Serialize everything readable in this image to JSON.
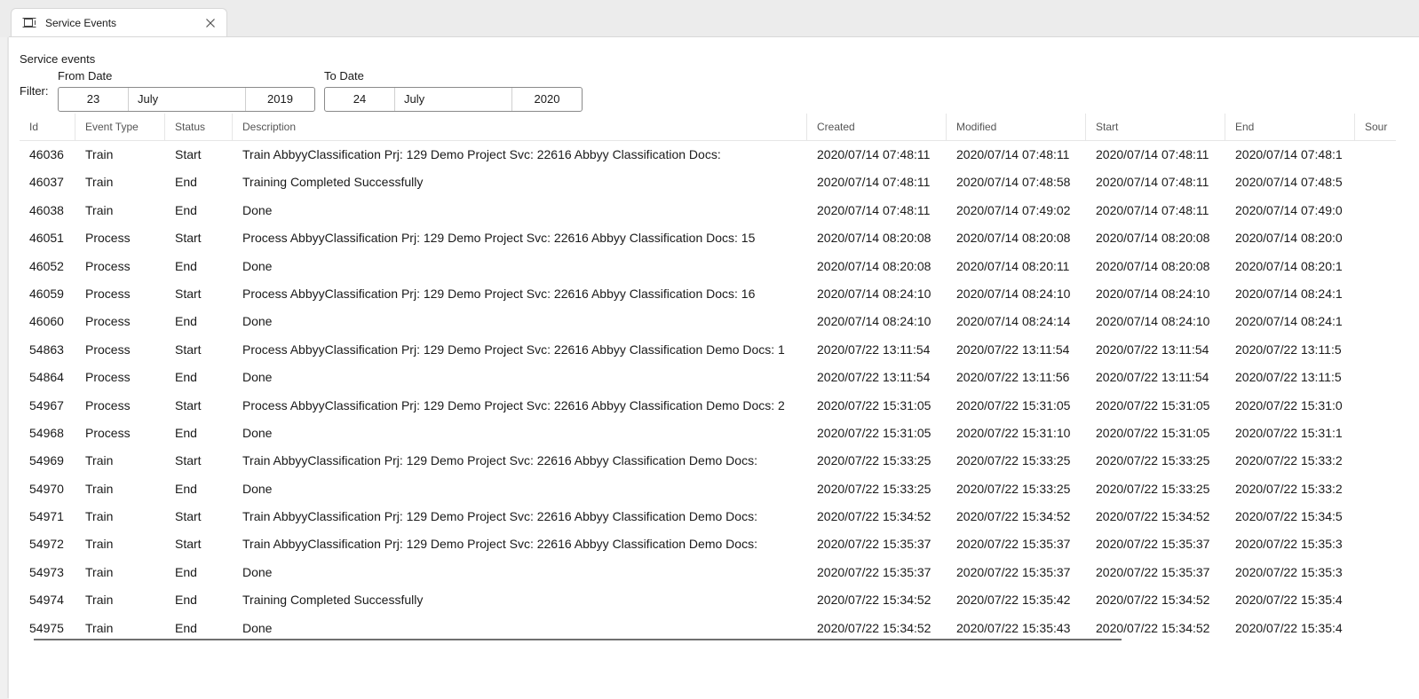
{
  "tab": {
    "title": "Service Events",
    "icon": "service-events-icon",
    "close_icon": "close-icon"
  },
  "page": {
    "title": "Service events",
    "filter_label": "Filter:",
    "from_date": {
      "label": "From Date",
      "day": "23",
      "month": "July",
      "year": "2019"
    },
    "to_date": {
      "label": "To Date",
      "day": "24",
      "month": "July",
      "year": "2020"
    }
  },
  "table": {
    "columns": [
      "Id",
      "Event Type",
      "Status",
      "Description",
      "Created",
      "Modified",
      "Start",
      "End",
      "Sour"
    ],
    "rows": [
      [
        "46036",
        "Train",
        "Start",
        "Train AbbyyClassification Prj: 129 Demo Project Svc: 22616 Abbyy Classification Docs:",
        "2020/07/14 07:48:11",
        "2020/07/14 07:48:11",
        "2020/07/14 07:48:11",
        "2020/07/14 07:48:1"
      ],
      [
        "46037",
        "Train",
        "End",
        "Training Completed Successfully",
        "2020/07/14 07:48:11",
        "2020/07/14 07:48:58",
        "2020/07/14 07:48:11",
        "2020/07/14 07:48:5"
      ],
      [
        "46038",
        "Train",
        "End",
        "Done",
        "2020/07/14 07:48:11",
        "2020/07/14 07:49:02",
        "2020/07/14 07:48:11",
        "2020/07/14 07:49:0"
      ],
      [
        "46051",
        "Process",
        "Start",
        "Process AbbyyClassification Prj: 129 Demo Project Svc: 22616 Abbyy Classification Docs: 15",
        "2020/07/14 08:20:08",
        "2020/07/14 08:20:08",
        "2020/07/14 08:20:08",
        "2020/07/14 08:20:0"
      ],
      [
        "46052",
        "Process",
        "End",
        "Done",
        "2020/07/14 08:20:08",
        "2020/07/14 08:20:11",
        "2020/07/14 08:20:08",
        "2020/07/14 08:20:1"
      ],
      [
        "46059",
        "Process",
        "Start",
        "Process AbbyyClassification Prj: 129 Demo Project Svc: 22616 Abbyy Classification Docs: 16",
        "2020/07/14 08:24:10",
        "2020/07/14 08:24:10",
        "2020/07/14 08:24:10",
        "2020/07/14 08:24:1"
      ],
      [
        "46060",
        "Process",
        "End",
        "Done",
        "2020/07/14 08:24:10",
        "2020/07/14 08:24:14",
        "2020/07/14 08:24:10",
        "2020/07/14 08:24:1"
      ],
      [
        "54863",
        "Process",
        "Start",
        "Process AbbyyClassification Prj: 129 Demo Project Svc: 22616 Abbyy Classification Demo Docs: 1",
        "2020/07/22 13:11:54",
        "2020/07/22 13:11:54",
        "2020/07/22 13:11:54",
        "2020/07/22 13:11:5"
      ],
      [
        "54864",
        "Process",
        "End",
        "Done",
        "2020/07/22 13:11:54",
        "2020/07/22 13:11:56",
        "2020/07/22 13:11:54",
        "2020/07/22 13:11:5"
      ],
      [
        "54967",
        "Process",
        "Start",
        "Process AbbyyClassification Prj: 129 Demo Project Svc: 22616 Abbyy Classification Demo Docs: 2",
        "2020/07/22 15:31:05",
        "2020/07/22 15:31:05",
        "2020/07/22 15:31:05",
        "2020/07/22 15:31:0"
      ],
      [
        "54968",
        "Process",
        "End",
        "Done",
        "2020/07/22 15:31:05",
        "2020/07/22 15:31:10",
        "2020/07/22 15:31:05",
        "2020/07/22 15:31:1"
      ],
      [
        "54969",
        "Train",
        "Start",
        "Train AbbyyClassification Prj: 129 Demo Project Svc: 22616 Abbyy Classification Demo Docs:",
        "2020/07/22 15:33:25",
        "2020/07/22 15:33:25",
        "2020/07/22 15:33:25",
        "2020/07/22 15:33:2"
      ],
      [
        "54970",
        "Train",
        "End",
        "Done",
        "2020/07/22 15:33:25",
        "2020/07/22 15:33:25",
        "2020/07/22 15:33:25",
        "2020/07/22 15:33:2"
      ],
      [
        "54971",
        "Train",
        "Start",
        "Train AbbyyClassification Prj: 129 Demo Project Svc: 22616 Abbyy Classification Demo Docs:",
        "2020/07/22 15:34:52",
        "2020/07/22 15:34:52",
        "2020/07/22 15:34:52",
        "2020/07/22 15:34:5"
      ],
      [
        "54972",
        "Train",
        "Start",
        "Train AbbyyClassification Prj: 129 Demo Project Svc: 22616 Abbyy Classification Demo Docs:",
        "2020/07/22 15:35:37",
        "2020/07/22 15:35:37",
        "2020/07/22 15:35:37",
        "2020/07/22 15:35:3"
      ],
      [
        "54973",
        "Train",
        "End",
        "Done",
        "2020/07/22 15:35:37",
        "2020/07/22 15:35:37",
        "2020/07/22 15:35:37",
        "2020/07/22 15:35:3"
      ],
      [
        "54974",
        "Train",
        "End",
        "Training Completed Successfully",
        "2020/07/22 15:34:52",
        "2020/07/22 15:35:42",
        "2020/07/22 15:34:52",
        "2020/07/22 15:35:4"
      ],
      [
        "54975",
        "Train",
        "End",
        "Done",
        "2020/07/22 15:34:52",
        "2020/07/22 15:35:43",
        "2020/07/22 15:34:52",
        "2020/07/22 15:35:4"
      ]
    ]
  }
}
